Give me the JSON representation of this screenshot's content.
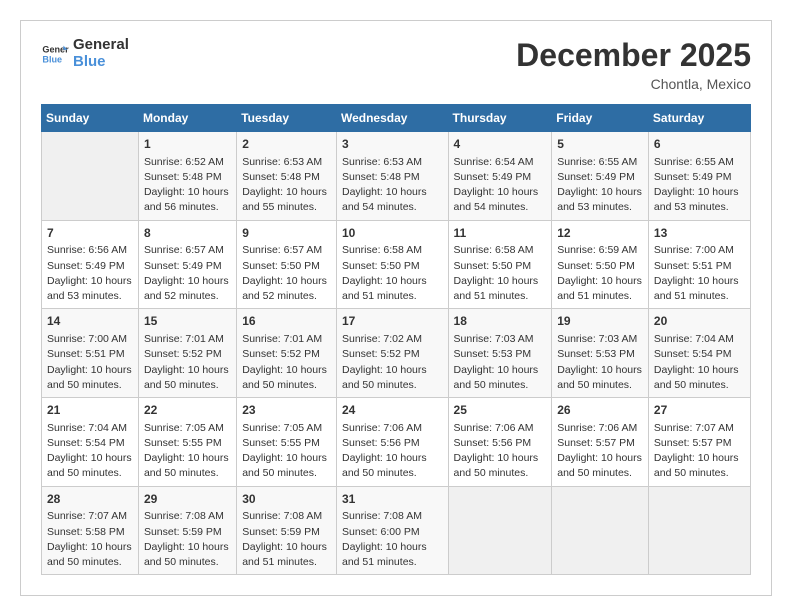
{
  "logo": {
    "line1": "General",
    "line2": "Blue"
  },
  "title": "December 2025",
  "subtitle": "Chontla, Mexico",
  "days_header": [
    "Sunday",
    "Monday",
    "Tuesday",
    "Wednesday",
    "Thursday",
    "Friday",
    "Saturday"
  ],
  "weeks": [
    [
      {
        "day": "",
        "empty": true
      },
      {
        "day": "1",
        "sunrise": "6:52 AM",
        "sunset": "5:48 PM",
        "daylight": "10 hours and 56 minutes."
      },
      {
        "day": "2",
        "sunrise": "6:53 AM",
        "sunset": "5:48 PM",
        "daylight": "10 hours and 55 minutes."
      },
      {
        "day": "3",
        "sunrise": "6:53 AM",
        "sunset": "5:48 PM",
        "daylight": "10 hours and 54 minutes."
      },
      {
        "day": "4",
        "sunrise": "6:54 AM",
        "sunset": "5:49 PM",
        "daylight": "10 hours and 54 minutes."
      },
      {
        "day": "5",
        "sunrise": "6:55 AM",
        "sunset": "5:49 PM",
        "daylight": "10 hours and 53 minutes."
      },
      {
        "day": "6",
        "sunrise": "6:55 AM",
        "sunset": "5:49 PM",
        "daylight": "10 hours and 53 minutes."
      }
    ],
    [
      {
        "day": "7",
        "sunrise": "6:56 AM",
        "sunset": "5:49 PM",
        "daylight": "10 hours and 53 minutes."
      },
      {
        "day": "8",
        "sunrise": "6:57 AM",
        "sunset": "5:49 PM",
        "daylight": "10 hours and 52 minutes."
      },
      {
        "day": "9",
        "sunrise": "6:57 AM",
        "sunset": "5:50 PM",
        "daylight": "10 hours and 52 minutes."
      },
      {
        "day": "10",
        "sunrise": "6:58 AM",
        "sunset": "5:50 PM",
        "daylight": "10 hours and 51 minutes."
      },
      {
        "day": "11",
        "sunrise": "6:58 AM",
        "sunset": "5:50 PM",
        "daylight": "10 hours and 51 minutes."
      },
      {
        "day": "12",
        "sunrise": "6:59 AM",
        "sunset": "5:50 PM",
        "daylight": "10 hours and 51 minutes."
      },
      {
        "day": "13",
        "sunrise": "7:00 AM",
        "sunset": "5:51 PM",
        "daylight": "10 hours and 51 minutes."
      }
    ],
    [
      {
        "day": "14",
        "sunrise": "7:00 AM",
        "sunset": "5:51 PM",
        "daylight": "10 hours and 50 minutes."
      },
      {
        "day": "15",
        "sunrise": "7:01 AM",
        "sunset": "5:52 PM",
        "daylight": "10 hours and 50 minutes."
      },
      {
        "day": "16",
        "sunrise": "7:01 AM",
        "sunset": "5:52 PM",
        "daylight": "10 hours and 50 minutes."
      },
      {
        "day": "17",
        "sunrise": "7:02 AM",
        "sunset": "5:52 PM",
        "daylight": "10 hours and 50 minutes."
      },
      {
        "day": "18",
        "sunrise": "7:03 AM",
        "sunset": "5:53 PM",
        "daylight": "10 hours and 50 minutes."
      },
      {
        "day": "19",
        "sunrise": "7:03 AM",
        "sunset": "5:53 PM",
        "daylight": "10 hours and 50 minutes."
      },
      {
        "day": "20",
        "sunrise": "7:04 AM",
        "sunset": "5:54 PM",
        "daylight": "10 hours and 50 minutes."
      }
    ],
    [
      {
        "day": "21",
        "sunrise": "7:04 AM",
        "sunset": "5:54 PM",
        "daylight": "10 hours and 50 minutes."
      },
      {
        "day": "22",
        "sunrise": "7:05 AM",
        "sunset": "5:55 PM",
        "daylight": "10 hours and 50 minutes."
      },
      {
        "day": "23",
        "sunrise": "7:05 AM",
        "sunset": "5:55 PM",
        "daylight": "10 hours and 50 minutes."
      },
      {
        "day": "24",
        "sunrise": "7:06 AM",
        "sunset": "5:56 PM",
        "daylight": "10 hours and 50 minutes."
      },
      {
        "day": "25",
        "sunrise": "7:06 AM",
        "sunset": "5:56 PM",
        "daylight": "10 hours and 50 minutes."
      },
      {
        "day": "26",
        "sunrise": "7:06 AM",
        "sunset": "5:57 PM",
        "daylight": "10 hours and 50 minutes."
      },
      {
        "day": "27",
        "sunrise": "7:07 AM",
        "sunset": "5:57 PM",
        "daylight": "10 hours and 50 minutes."
      }
    ],
    [
      {
        "day": "28",
        "sunrise": "7:07 AM",
        "sunset": "5:58 PM",
        "daylight": "10 hours and 50 minutes."
      },
      {
        "day": "29",
        "sunrise": "7:08 AM",
        "sunset": "5:59 PM",
        "daylight": "10 hours and 50 minutes."
      },
      {
        "day": "30",
        "sunrise": "7:08 AM",
        "sunset": "5:59 PM",
        "daylight": "10 hours and 51 minutes."
      },
      {
        "day": "31",
        "sunrise": "7:08 AM",
        "sunset": "6:00 PM",
        "daylight": "10 hours and 51 minutes."
      },
      {
        "day": "",
        "empty": true
      },
      {
        "day": "",
        "empty": true
      },
      {
        "day": "",
        "empty": true
      }
    ]
  ],
  "labels": {
    "sunrise_prefix": "Sunrise: ",
    "sunset_prefix": "Sunset: ",
    "daylight_prefix": "Daylight: "
  }
}
